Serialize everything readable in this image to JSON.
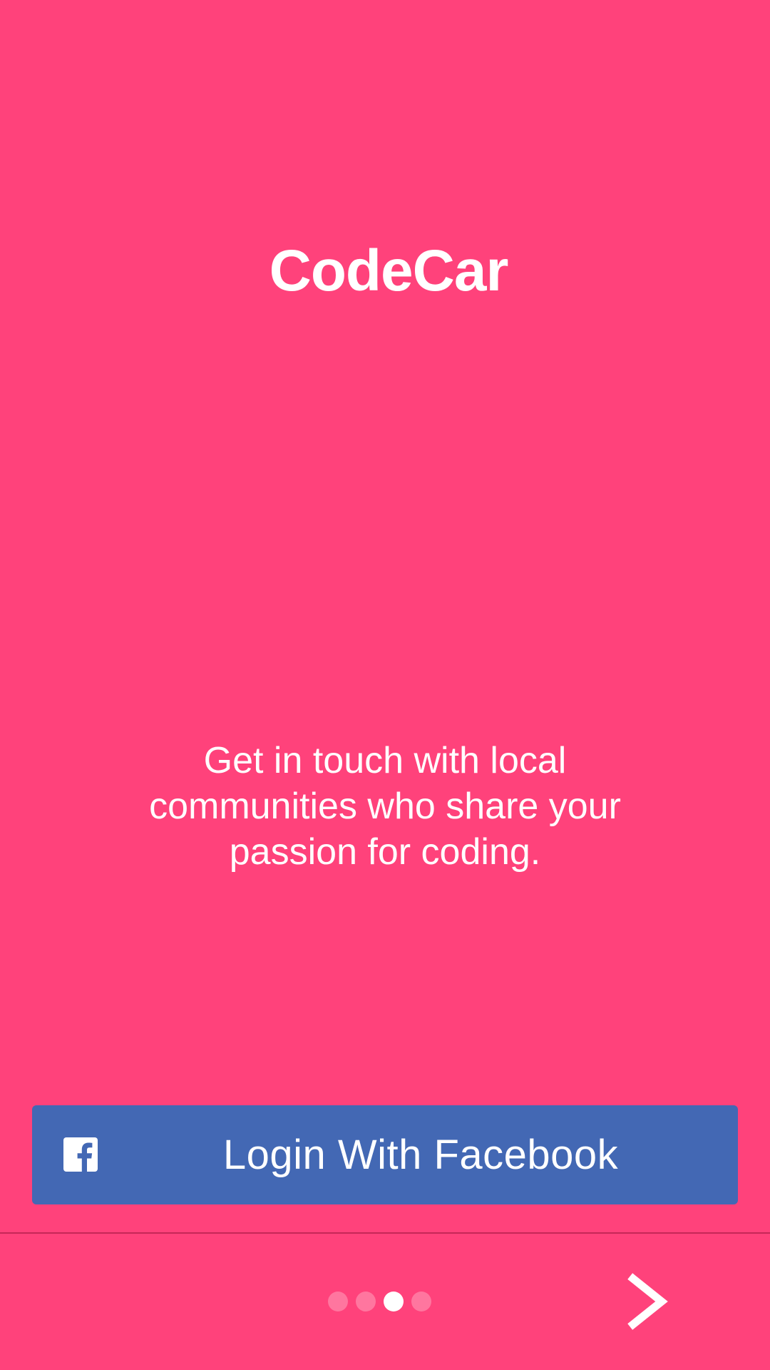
{
  "app": {
    "title": "CodeCar"
  },
  "onboarding": {
    "tagline": "Get in touch with local communities who share your passion for coding."
  },
  "login": {
    "facebook_label": "Login With Facebook",
    "facebook_icon": "facebook-icon"
  },
  "pager": {
    "total": 4,
    "active_index": 2
  },
  "navigation": {
    "next_icon": "chevron-right-icon"
  },
  "colors": {
    "background": "#ff427b",
    "facebook_blue": "#4368b4",
    "text": "#ffffff"
  }
}
